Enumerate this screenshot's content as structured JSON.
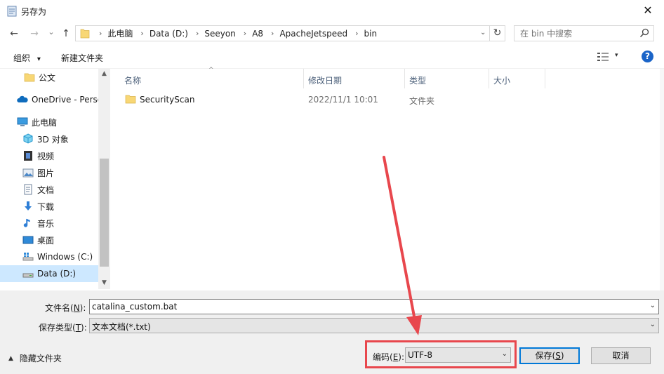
{
  "window": {
    "title": "另存为",
    "close_label": "✕"
  },
  "nav": {
    "back": "←",
    "forward": "→",
    "recent": "⌄",
    "up": "↑"
  },
  "address": {
    "crumbs": [
      "此电脑",
      "Data (D:)",
      "Seeyon",
      "A8",
      "ApacheJetspeed",
      "bin"
    ],
    "separator": "›",
    "dropdown": "⌄",
    "refresh": "↻"
  },
  "search": {
    "placeholder": "在 bin 中搜索"
  },
  "toolbar": {
    "organize": "组织",
    "organize_caret": "▾",
    "new_folder": "新建文件夹",
    "view_caret": "▾",
    "help": "?"
  },
  "sidebar": {
    "items": [
      {
        "label": "公文",
        "icon": "folder-icon"
      },
      {
        "label": "OneDrive - Perso",
        "icon": "cloud-icon"
      },
      {
        "label": "此电脑",
        "icon": "computer-icon"
      },
      {
        "label": "3D 对象",
        "icon": "cube-icon"
      },
      {
        "label": "视频",
        "icon": "film-icon"
      },
      {
        "label": "图片",
        "icon": "picture-icon"
      },
      {
        "label": "文档",
        "icon": "document-icon"
      },
      {
        "label": "下载",
        "icon": "download-icon"
      },
      {
        "label": "音乐",
        "icon": "music-icon"
      },
      {
        "label": "桌面",
        "icon": "desktop-icon"
      },
      {
        "label": "Windows (C:)",
        "icon": "windows-drive-icon"
      },
      {
        "label": "Data (D:)",
        "icon": "drive-icon"
      }
    ],
    "selected": "Data (D:)",
    "scroll_up": "▲",
    "scroll_down": "▼"
  },
  "file_list": {
    "sort_caret": "^",
    "columns": [
      "名称",
      "修改日期",
      "类型",
      "大小"
    ],
    "rows": [
      {
        "name": "SecurityScan",
        "modified": "2022/11/1 10:01",
        "type": "文件夹",
        "size": ""
      }
    ]
  },
  "form": {
    "filename_label": {
      "pre": "文件名(",
      "key": "N",
      "post": "):"
    },
    "filename_value": "catalina_custom.bat",
    "filetype_label": {
      "pre": "保存类型(",
      "key": "T",
      "post": "):"
    },
    "filetype_value": "文本文档(*.txt)",
    "encoding_label": {
      "pre": "编码(",
      "key": "E",
      "post": "):"
    },
    "encoding_value": "UTF-8",
    "dropdown": "⌄"
  },
  "buttons": {
    "save": {
      "pre": "保存(",
      "key": "S",
      "post": ")"
    },
    "cancel": "取消",
    "hide_folders": "隐藏文件夹",
    "hide_caret": "▲"
  },
  "colors": {
    "highlight_box": "#e8474d",
    "selected_bg": "#cde8ff",
    "accent": "#0078d7",
    "folder": "#f8d775"
  }
}
